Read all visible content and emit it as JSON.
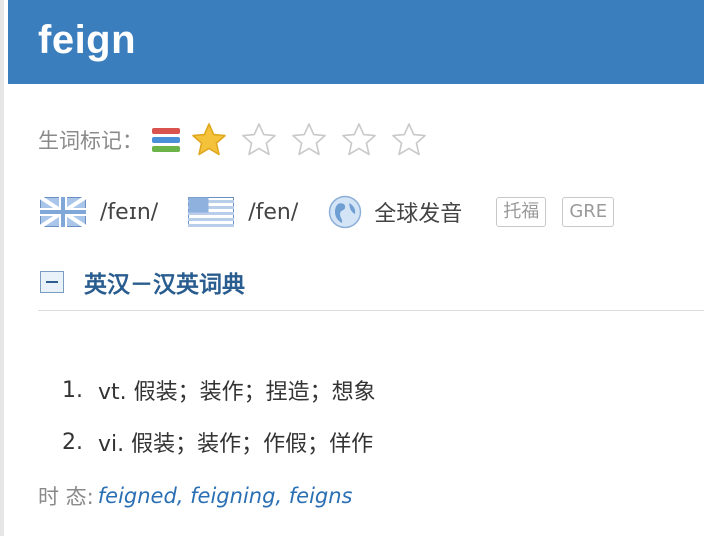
{
  "header": {
    "word": "feign",
    "bg_color": "#3a7ebd"
  },
  "wordbook": {
    "label": "生词标记：",
    "rating": 1,
    "max_rating": 5,
    "star_color": "#f4c23b"
  },
  "pronunciation": {
    "uk": {
      "icon": "uk-flag-icon",
      "phonetic": "/feɪn/"
    },
    "us": {
      "icon": "us-flag-icon",
      "phonetic": "/fen/"
    },
    "global": {
      "icon": "globe-icon",
      "label": "全球发音"
    },
    "tags": [
      "托福",
      "GRE"
    ]
  },
  "section": {
    "title": "英汉－汉英词典",
    "collapse_symbol": "−"
  },
  "definitions": [
    {
      "num": "1.",
      "text": "vt. 假装；装作；捏造；想象"
    },
    {
      "num": "2.",
      "text": "vi. 假装；装作；作假；佯作"
    }
  ],
  "tense": {
    "label": "时 态:",
    "forms": "feigned, feigning, feigns"
  }
}
